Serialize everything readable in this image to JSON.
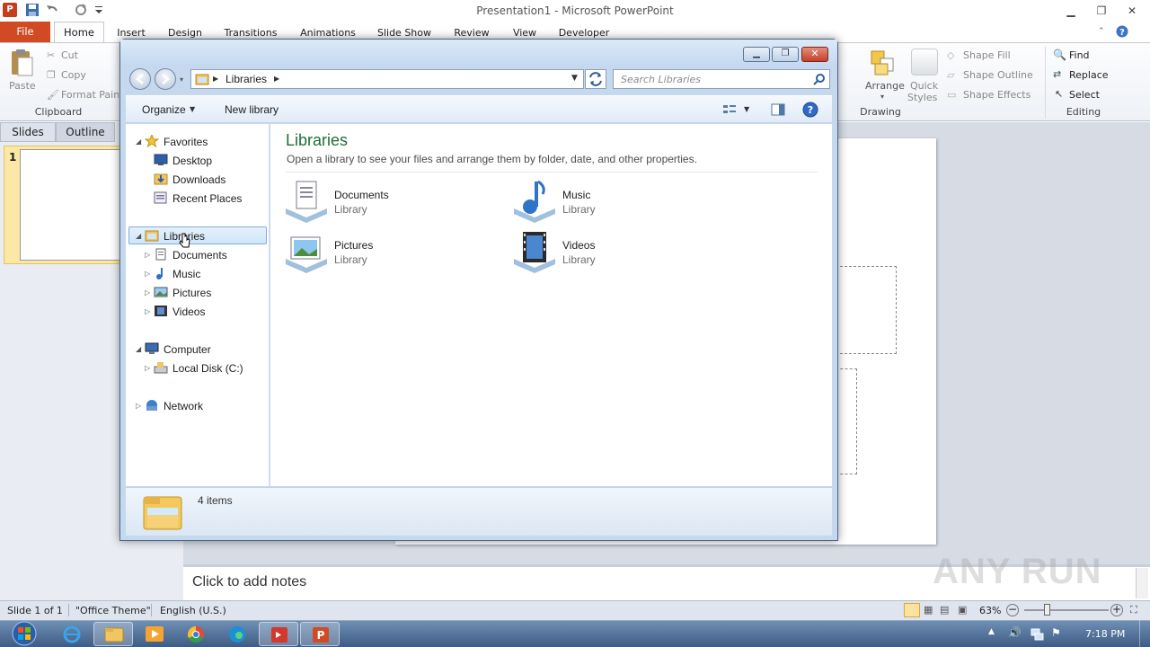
{
  "powerpoint": {
    "title": "Presentation1 - Microsoft PowerPoint",
    "tabs": [
      "File",
      "Home",
      "Insert",
      "Design",
      "Transitions",
      "Animations",
      "Slide Show",
      "Review",
      "View",
      "Developer"
    ],
    "clipboard": {
      "paste": "Paste",
      "cut": "Cut",
      "copy": "Copy",
      "format_painter": "Format Painter",
      "group": "Clipboard"
    },
    "drawing": {
      "arrange": "Arrange",
      "quick_styles_1": "Quick",
      "quick_styles_2": "Styles",
      "shape_fill": "Shape Fill",
      "shape_outline": "Shape Outline",
      "shape_effects": "Shape Effects",
      "group": "Drawing"
    },
    "editing": {
      "find": "Find",
      "replace": "Replace",
      "select": "Select",
      "group": "Editing"
    },
    "pane_tabs": {
      "slides": "Slides",
      "outline": "Outline"
    },
    "slide_number": "1",
    "notes_placeholder": "Click to add notes",
    "status": {
      "slide": "Slide 1 of 1",
      "theme": "\"Office Theme\"",
      "language": "English (U.S.)",
      "zoom": "63%"
    }
  },
  "explorer": {
    "breadcrumb": "Libraries",
    "search_placeholder": "Search Libraries",
    "toolbar": {
      "organize": "Organize",
      "new_library": "New library"
    },
    "nav": {
      "favorites": "Favorites",
      "desktop": "Desktop",
      "downloads": "Downloads",
      "recent": "Recent Places",
      "libraries": "Libraries",
      "documents": "Documents",
      "music": "Music",
      "pictures": "Pictures",
      "videos": "Videos",
      "computer": "Computer",
      "local_disk": "Local Disk (C:)",
      "network": "Network"
    },
    "heading": "Libraries",
    "subheading": "Open a library to see your files and arrange them by folder, date, and other properties.",
    "libraries": [
      {
        "name": "Documents",
        "type": "Library"
      },
      {
        "name": "Music",
        "type": "Library"
      },
      {
        "name": "Pictures",
        "type": "Library"
      },
      {
        "name": "Videos",
        "type": "Library"
      }
    ],
    "item_count": "4 items"
  },
  "taskbar": {
    "clock": "7:18 PM"
  },
  "watermark": "ANY RUN"
}
